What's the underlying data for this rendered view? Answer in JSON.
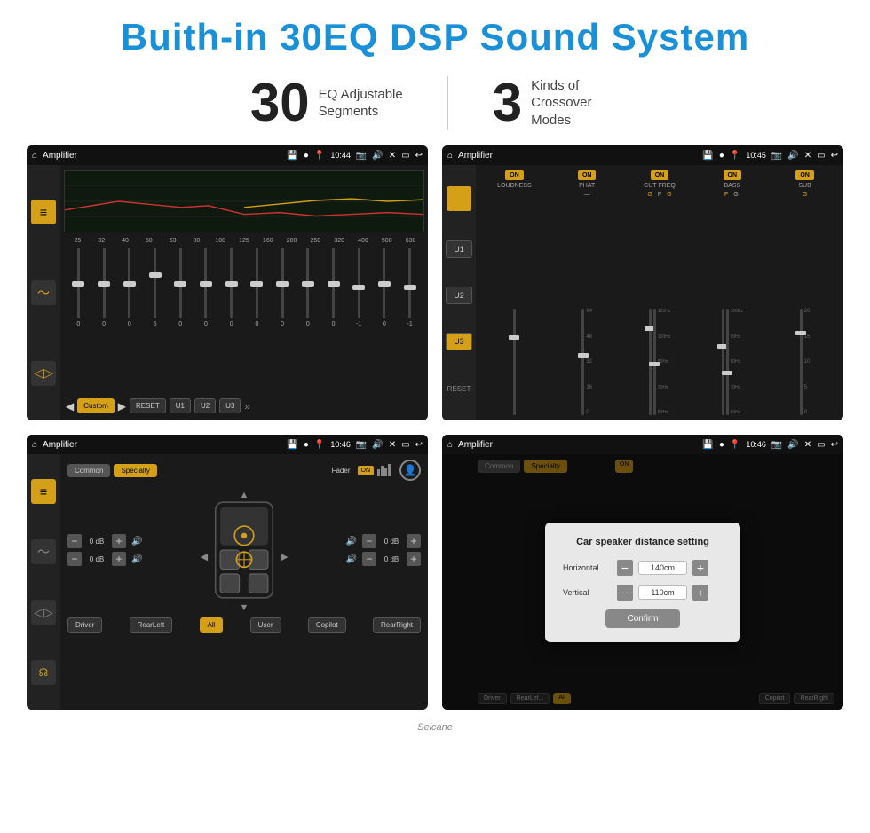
{
  "header": {
    "title": "Buith-in 30EQ DSP Sound System"
  },
  "stats": [
    {
      "number": "30",
      "label": "EQ Adjustable\nSegments"
    },
    {
      "number": "3",
      "label": "Kinds of\nCrossover Modes"
    }
  ],
  "screen1": {
    "title": "Amplifier",
    "time": "10:44",
    "eq_frequencies": [
      "25",
      "32",
      "40",
      "50",
      "63",
      "80",
      "100",
      "125",
      "160",
      "200",
      "250",
      "320",
      "400",
      "500",
      "630"
    ],
    "eq_values": [
      "0",
      "0",
      "0",
      "5",
      "0",
      "0",
      "0",
      "0",
      "0",
      "0",
      "0",
      "-1",
      "0",
      "-1"
    ],
    "presets": [
      "Custom",
      "RESET",
      "U1",
      "U2",
      "U3"
    ]
  },
  "screen2": {
    "title": "Amplifier",
    "time": "10:45",
    "channels": [
      "LOUDNESS",
      "PHAT",
      "CUT FREQ",
      "BASS",
      "SUB"
    ],
    "u_buttons": [
      "U1",
      "U2",
      "U3"
    ],
    "active_u": "U3"
  },
  "screen3": {
    "title": "Amplifier",
    "time": "10:46",
    "tabs": [
      "Common",
      "Specialty"
    ],
    "fader_label": "Fader",
    "fader_state": "ON",
    "db_values": [
      "0 dB",
      "0 dB",
      "0 dB",
      "0 dB"
    ],
    "bottom_buttons": [
      "Driver",
      "RearLeft",
      "All",
      "User",
      "Copilot",
      "RearRight"
    ]
  },
  "screen4": {
    "title": "Amplifier",
    "time": "10:46",
    "dialog": {
      "title": "Car speaker distance setting",
      "horizontal_label": "Horizontal",
      "horizontal_value": "140cm",
      "vertical_label": "Vertical",
      "vertical_value": "110cm",
      "confirm_label": "Confirm"
    }
  },
  "watermark": "Seicane"
}
